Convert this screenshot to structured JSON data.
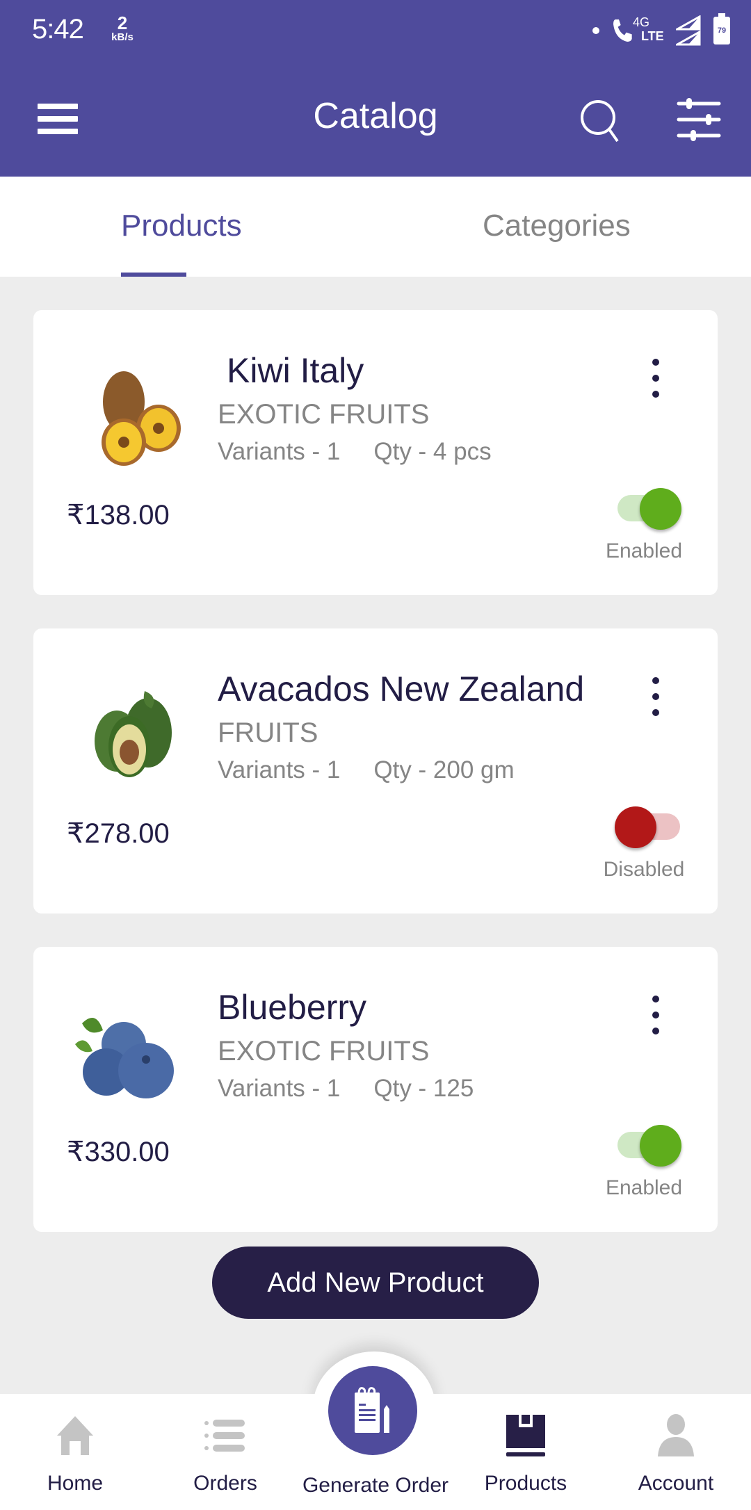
{
  "status_bar": {
    "time": "5:42",
    "net_speed_value": "2",
    "net_speed_unit": "kB/s",
    "network_label_top": "4G",
    "network_label_bottom": "LTE",
    "battery": "79"
  },
  "app_bar": {
    "title": "Catalog",
    "icons": [
      "menu-icon",
      "search-icon",
      "filter-sliders-icon"
    ]
  },
  "tabs": [
    {
      "label": "Products",
      "active": true
    },
    {
      "label": "Categories",
      "active": false
    }
  ],
  "products": [
    {
      "name": "Kiwi Italy",
      "category": "EXOTIC FRUITS",
      "variants": "Variants - 1",
      "qty": "Qty - 4 pcs",
      "price": "₹138.00",
      "status": "Enabled",
      "enabled": true,
      "image": "kiwi-image"
    },
    {
      "name": "Avacados New Zealand",
      "category": "FRUITS",
      "variants": "Variants - 1",
      "qty": "Qty - 200 gm",
      "price": "₹278.00",
      "status": "Disabled",
      "enabled": false,
      "image": "avocado-image"
    },
    {
      "name": "Blueberry",
      "category": "EXOTIC FRUITS",
      "variants": "Variants - 1",
      "qty": "Qty - 125",
      "price": "₹330.00",
      "status": "Enabled",
      "enabled": true,
      "image": "blueberry-image"
    }
  ],
  "add_button": "Add New Product",
  "bottom_nav": [
    {
      "label": "Home",
      "icon": "home-icon",
      "active": false
    },
    {
      "label": "Orders",
      "icon": "list-icon",
      "active": false
    },
    {
      "label": "Generate Order",
      "icon": "notepad-pencil-icon",
      "active": false
    },
    {
      "label": "Products",
      "icon": "box-icon",
      "active": true
    },
    {
      "label": "Account",
      "icon": "person-icon",
      "active": false
    }
  ],
  "colors": {
    "primary": "#4f4b9c",
    "dark": "#221d45",
    "enabled": "#5fad1c",
    "disabled": "#b21818",
    "muted": "#858585"
  }
}
